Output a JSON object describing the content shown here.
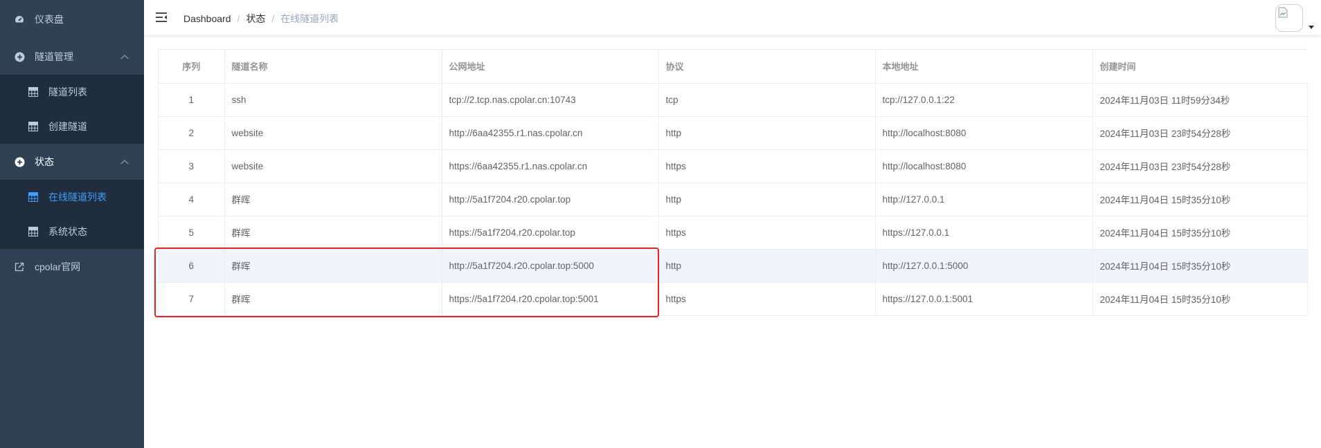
{
  "sidebar": {
    "dashboard": {
      "label": "仪表盘",
      "icon": "speedometer-icon"
    },
    "tunnel_mgmt": {
      "label": "隧道管理",
      "icon": "plus-circle-icon"
    },
    "tunnel_list": {
      "label": "隧道列表",
      "icon": "grid-icon"
    },
    "create_tunnel": {
      "label": "创建隧道",
      "icon": "grid-icon"
    },
    "status": {
      "label": "状态",
      "icon": "plus-circle-icon"
    },
    "online_list": {
      "label": "在线隧道列表",
      "icon": "grid-icon"
    },
    "system_status": {
      "label": "系统状态",
      "icon": "grid-icon"
    },
    "official": {
      "label": "cpolar官网",
      "icon": "external-link-icon"
    }
  },
  "breadcrumb": {
    "home": "Dashboard",
    "sep": "/",
    "level1": "状态",
    "current": "在线隧道列表"
  },
  "table": {
    "headers": {
      "index": "序列",
      "name": "隧道名称",
      "public": "公网地址",
      "protocol": "协议",
      "local": "本地地址",
      "created": "创建时间"
    },
    "rows": [
      {
        "index": "1",
        "name": "ssh",
        "public": "tcp://2.tcp.nas.cpolar.cn:10743",
        "protocol": "tcp",
        "local": "tcp://127.0.0.1:22",
        "created": "2024年11月03日 11时59分34秒"
      },
      {
        "index": "2",
        "name": "website",
        "public": "http://6aa42355.r1.nas.cpolar.cn",
        "protocol": "http",
        "local": "http://localhost:8080",
        "created": "2024年11月03日 23时54分28秒"
      },
      {
        "index": "3",
        "name": "website",
        "public": "https://6aa42355.r1.nas.cpolar.cn",
        "protocol": "https",
        "local": "http://localhost:8080",
        "created": "2024年11月03日 23时54分28秒"
      },
      {
        "index": "4",
        "name": "群晖",
        "public": "http://5a1f7204.r20.cpolar.top",
        "protocol": "http",
        "local": "http://127.0.0.1",
        "created": "2024年11月04日 15时35分10秒"
      },
      {
        "index": "5",
        "name": "群晖",
        "public": "https://5a1f7204.r20.cpolar.top",
        "protocol": "https",
        "local": "https://127.0.0.1",
        "created": "2024年11月04日 15时35分10秒"
      },
      {
        "index": "6",
        "name": "群晖",
        "public": "http://5a1f7204.r20.cpolar.top:5000",
        "protocol": "http",
        "local": "http://127.0.0.1:5000",
        "created": "2024年11月04日 15时35分10秒"
      },
      {
        "index": "7",
        "name": "群晖",
        "public": "https://5a1f7204.r20.cpolar.top:5001",
        "protocol": "https",
        "local": "https://127.0.0.1:5001",
        "created": "2024年11月04日 15时35分10秒"
      }
    ]
  },
  "colors": {
    "sidebar_bg": "#304156",
    "submenu_bg": "#1f2d3d",
    "sidebar_text": "#bfcbd9",
    "active": "#409eff",
    "highlight": "#e8231f",
    "row_hover": "#f0f5fd"
  }
}
